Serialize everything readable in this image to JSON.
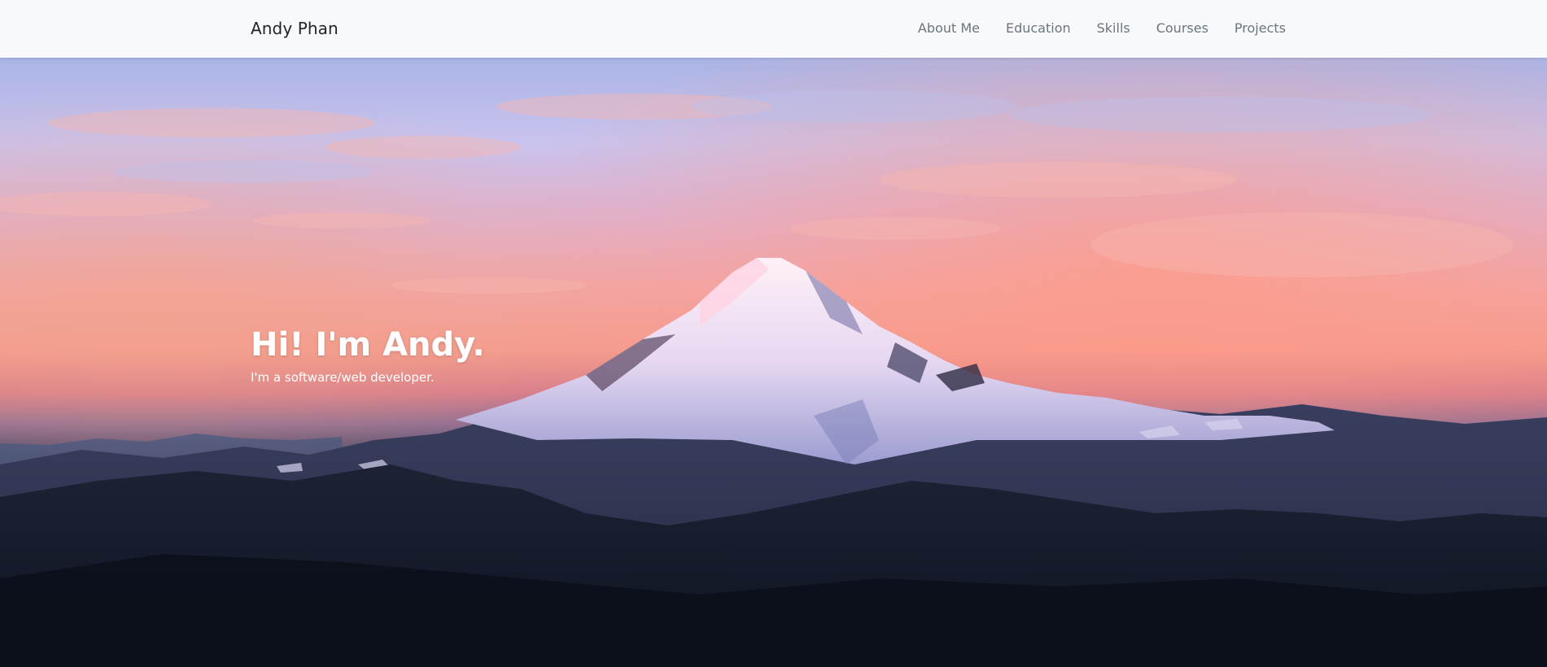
{
  "navbar": {
    "brand": "Andy Phan",
    "items": [
      {
        "label": "About Me"
      },
      {
        "label": "Education"
      },
      {
        "label": "Skills"
      },
      {
        "label": "Courses"
      },
      {
        "label": "Projects"
      }
    ]
  },
  "hero": {
    "title": "Hi! I'm Andy.",
    "subtitle": "I'm a software/web developer."
  },
  "colors": {
    "navbar_bg": "#f8f9fa",
    "brand_text": "#212529",
    "nav_text": "#6c757d",
    "hero_text": "#ffffff"
  }
}
